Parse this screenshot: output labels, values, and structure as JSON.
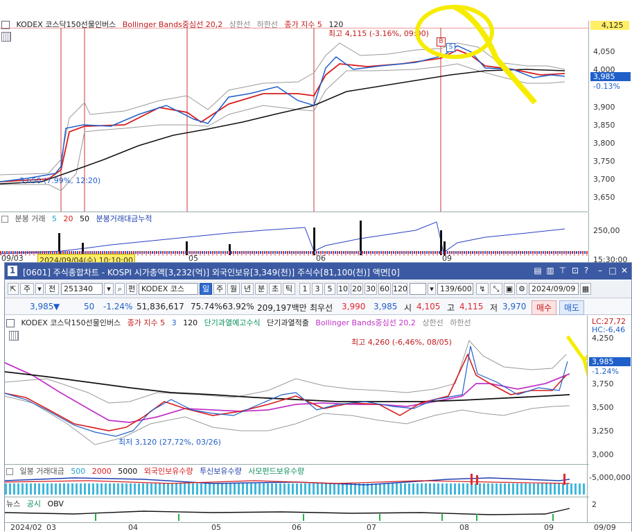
{
  "top_chart": {
    "legend": {
      "name": "KODEX 코스닥150선물인버스",
      "bb": "Bollinger Bands중심선 20,2",
      "upper": "상한선",
      "lower": "하한선",
      "ma_label": "종가 지수 5",
      "ma_val": "120"
    },
    "y_ticks": [
      "4,050",
      "4,000",
      "3,950",
      "3,900",
      "3,850",
      "3,800",
      "3,750",
      "3,700",
      "3,650"
    ],
    "price_top_badge": "4,125",
    "price_current_badge": "3,985",
    "pct_label": "-0.13%",
    "high_annotation": "최고 4,115 (-3.16%, 09:00)",
    "low_annotation": "3,650 (7.99%, 12:20)",
    "marker_b": "B",
    "marker_s": "S",
    "volume_legend": {
      "label": "분봉 거래",
      "v5": "5",
      "v20": "20",
      "v50": "50",
      "cum": "분봉거래대금누적"
    },
    "volume_tick": "250,00",
    "date_left": "09/03",
    "date_cursor": "2024/09/04(수) 10:10:00",
    "x_labels": [
      "05",
      "06",
      "09"
    ],
    "time_label": "15:30:00"
  },
  "window": {
    "title": "[0601] 주식종합차트 - KOSPI 시가총액[3,232(억)] 외국인보유[3,349(천)] 주식수[81,100(천)] 액면[0]",
    "window_number": "1",
    "toolbar": {
      "period_buttons": [
        "주",
        "전"
      ],
      "code_value": "251340",
      "stock_button": "펀",
      "stock_name": "KODEX 코스",
      "tabs": [
        "일",
        "주",
        "월",
        "년",
        "분",
        "초",
        "틱"
      ],
      "active_tab": "일",
      "intervals": [
        "1",
        "3",
        "5",
        "10",
        "20",
        "30",
        "60",
        "120"
      ],
      "count_value": "139/600",
      "date_value": "2024/09/09"
    },
    "quote": {
      "price": "3,985",
      "arrow": "▼",
      "change": "50",
      "change_pct": "-1.24%",
      "volume": "51,836,617",
      "ratio1": "75.74%",
      "ratio2": "63.92%",
      "amount": "209,197백만",
      "bid_label": "최우선",
      "bid": "3,990",
      "ask": "3,985",
      "open_label": "시",
      "open": "4,105",
      "high_label": "고",
      "high": "4,115",
      "low_label": "저",
      "low": "3,970",
      "buy": "매수",
      "sell": "매도"
    },
    "chart": {
      "legend": {
        "name": "KODEX 코스닥150선물인버스",
        "ma": "종가 지수 5",
        "ma3": "3",
        "ma120": "120",
        "ind1": "단기과열예고수식",
        "ind2": "단기과열적출",
        "bb": "Bollinger Bands중심선 20,2",
        "upper": "상한선",
        "lower": "하한선"
      },
      "lc_label": "LC:27,72",
      "hc_label": "HC:-6,46",
      "y_ticks": [
        "4,250",
        "4,000",
        "3,750",
        "3,500",
        "3,250",
        "3,000"
      ],
      "price_badge": "3,985",
      "pct_label": "-1.24%",
      "high_annotation": "최고 4,260 (-6,46%, 08/05)",
      "low_annotation": "최저 3,120 (27,72%, 03/26)",
      "volume_legend": {
        "label": "일봉 거래대금",
        "v500": "500",
        "v2000": "2000",
        "v5000": "5000",
        "foreign": "외국인보유수량",
        "trust": "투신보유수량",
        "private": "사모펀드보유수량"
      },
      "volume_tick": "-5,000,000",
      "obv_legend": {
        "news": "뉴스",
        "disclosure": "공시",
        "obv": "OBV"
      },
      "obv_tick": "2",
      "x_labels": [
        "2024/02",
        "03",
        "04",
        "05",
        "06",
        "07",
        "08",
        "09"
      ],
      "end_date": "09/09"
    }
  },
  "colors": {
    "title_bar": "#3b5aa3",
    "up": "#e0282e",
    "down": "#1f5fc9",
    "ma": "#d81b1b",
    "ma120": "#111111",
    "bb_mid": "#c233c7",
    "highlight": "#f6ec00"
  }
}
